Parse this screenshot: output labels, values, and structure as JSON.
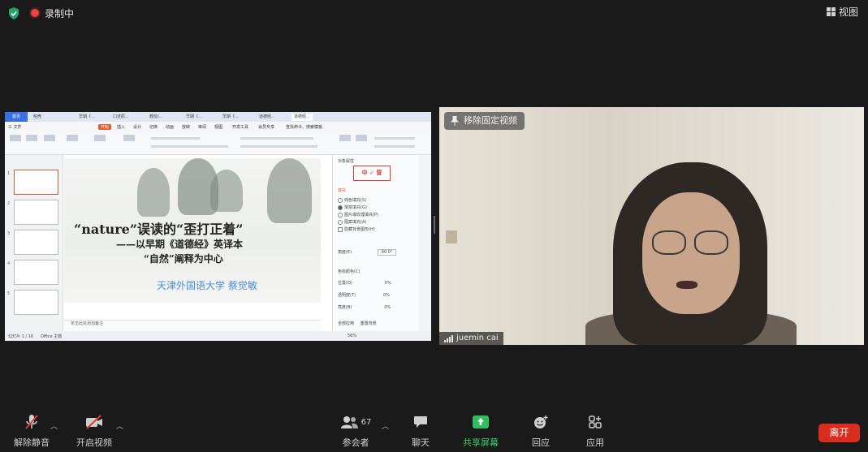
{
  "topbar": {
    "recording_label": "录制中",
    "view_label": "视图"
  },
  "shared_screen": {
    "tabs": [
      "首页",
      "稻壳",
      "早期《...",
      "口述原...",
      "教授/...",
      "早期《...",
      "早期《...",
      "道德经...",
      "道德经..."
    ],
    "menu": [
      "三 文件",
      "开始",
      "插入",
      "设计",
      "切换",
      "动画",
      "放映",
      "审阅",
      "视图",
      "开发工具",
      "会员专享",
      "查找命令、搜索模板"
    ],
    "menu_active": "开始",
    "slide": {
      "title": "“nature”误读的“歪打正着”",
      "subtitle1": "——以早期《道德经》英译本",
      "subtitle2": "“自然”阐释为中心",
      "author": "天津外国语大学    蔡觉敏"
    },
    "thumb_numbers": [
      "1",
      "2",
      "3",
      "4",
      "5"
    ],
    "notes_placeholder": "单击此处添加备注",
    "status_left": "幻灯片 1 / 16",
    "status_theme": "Office 主题",
    "status_zoom": "56%",
    "panel": {
      "header": "对象属性",
      "section": "填充",
      "options": [
        "纯色填充(S)",
        "渐变填充(G)",
        "图片或纹理填充(P)",
        "图案填充(A)",
        "隐藏背景图形(H)"
      ],
      "selected_option": 1,
      "angle_label": "角度(E)",
      "angle_value": "90.0°",
      "stop_color": "色标颜色(C)",
      "position": "位置(O)",
      "transparency": "透明度(T)",
      "brightness": "亮度(B)",
      "percent": "0%",
      "apply_all": "全部应用",
      "reset": "重置背景"
    },
    "stamp_text": "中 ✓ 冒"
  },
  "video": {
    "unpin_label": "移除固定视频",
    "participant_name": "juemin cai"
  },
  "toolbar": {
    "unmute": "解除静音",
    "start_video": "开启视频",
    "participants": "参会者",
    "participant_count": "67",
    "chat": "聊天",
    "share_screen": "共享屏幕",
    "reactions": "回应",
    "apps": "应用",
    "leave": "离开"
  }
}
